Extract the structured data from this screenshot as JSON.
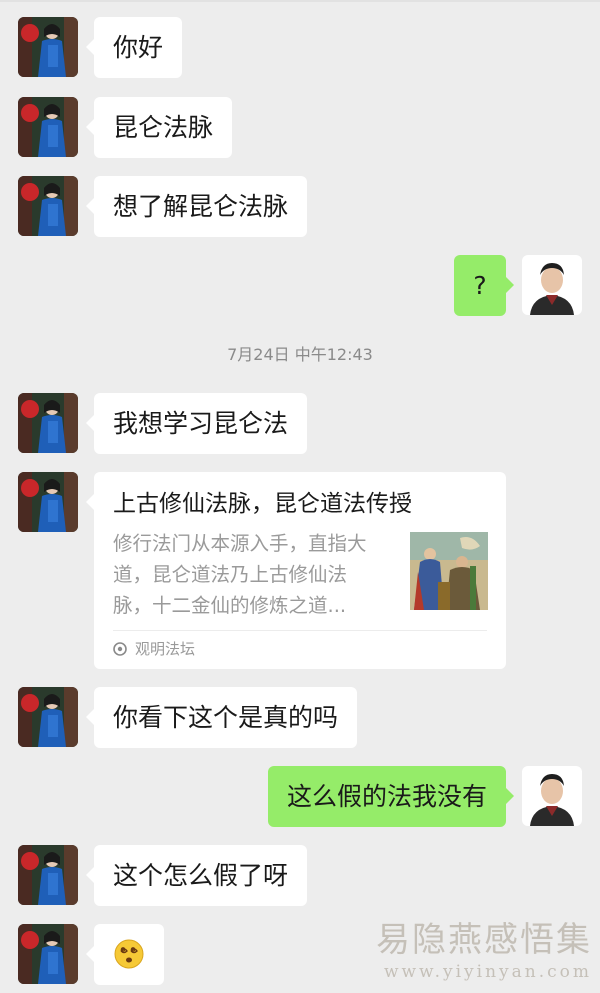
{
  "messages": [
    {
      "side": "in",
      "text": "你好"
    },
    {
      "side": "in",
      "text": "昆仑法脉"
    },
    {
      "side": "in",
      "text": "想了解昆仑法脉"
    },
    {
      "side": "out",
      "text": "?"
    },
    {
      "side": "in",
      "text": "我想学习昆仑法"
    },
    {
      "side": "in",
      "text": "你看下这个是真的吗"
    },
    {
      "side": "out",
      "text": "这么假的法我没有"
    },
    {
      "side": "in",
      "text": "这个怎么假了呀"
    }
  ],
  "timestamp": "7月24日 中午12:43",
  "link_card": {
    "title": "上古修仙法脉，昆仑道法传授",
    "description": "修行法门从本源入手，直指大道，昆仑道法乃上古修仙法脉，十二金仙的修炼之道...",
    "source": "观明法坛",
    "thumbnail_icon": "painting-thumbnail-icon"
  },
  "emoji_message": {
    "icon": "dizzy-face-emoji-icon"
  },
  "watermark": {
    "text": "易隐燕感悟集",
    "url": "www.yiyinyan.com"
  },
  "colors": {
    "background": "#ededed",
    "incoming_bubble": "#ffffff",
    "outgoing_bubble": "#95ec69"
  }
}
